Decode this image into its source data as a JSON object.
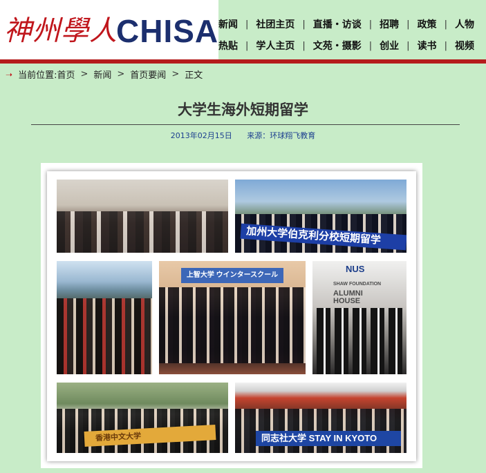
{
  "header": {
    "logo_cn": "神州學人",
    "logo_en": "CHISA",
    "nav_row1": [
      "新闻",
      "社团主页",
      "直播・访谈",
      "招聘",
      "政策",
      "人物"
    ],
    "nav_row2": [
      "热贴",
      "学人主页",
      "文苑・摄影",
      "创业",
      "读书",
      "视频"
    ]
  },
  "breadcrumb": {
    "label": "当前位置:",
    "items": [
      "首页",
      "新闻",
      "首页要闻",
      "正文"
    ]
  },
  "article": {
    "title": "大学生海外短期留学",
    "date": "2013年02月15日",
    "source": "来源：环球翔飞教育"
  },
  "photos": {
    "banner_berkeley": "加州大学伯克利分校短期留学",
    "sign_japanese": "上智大学 ウインタースクール",
    "sign_nus": "NUS",
    "sign_shaw": "SHAW FOUNDATION",
    "sign_alumni": "ALUMNI HOUSE",
    "banner_cuhk": "香港中文大学",
    "banner_kyoto": "同志社大学 STAY IN KYOTO"
  }
}
